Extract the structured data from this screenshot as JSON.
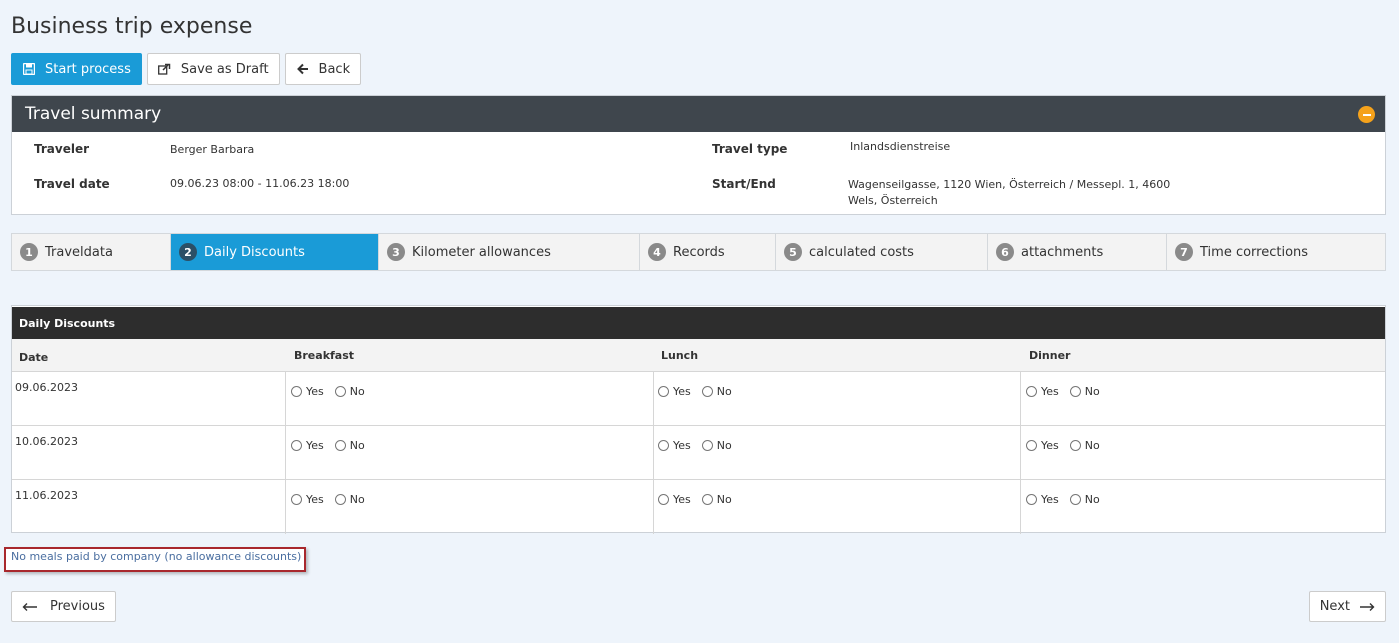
{
  "page": {
    "title": "Business trip expense"
  },
  "toolbar": {
    "start_label": "Start process",
    "draft_label": "Save as Draft",
    "back_label": "Back"
  },
  "summary": {
    "title": "Travel summary",
    "traveler_label": "Traveler",
    "traveler_value": "Berger Barbara",
    "date_label": "Travel date",
    "date_value": "09.06.23 08:00 - 11.06.23 18:00",
    "type_label": "Travel type",
    "type_value": "Inlandsdienstreise",
    "startend_label": "Start/End",
    "startend_line1": "Wagenseilgasse, 1120 Wien, Österreich / Messepl. 1, 4600",
    "startend_line2": "Wels, Österreich"
  },
  "tabs": [
    {
      "num": "1",
      "label": "Traveldata"
    },
    {
      "num": "2",
      "label": "Daily Discounts"
    },
    {
      "num": "3",
      "label": "Kilometer allowances"
    },
    {
      "num": "4",
      "label": "Records"
    },
    {
      "num": "5",
      "label": "calculated costs"
    },
    {
      "num": "6",
      "label": "attachments"
    },
    {
      "num": "7",
      "label": "Time corrections"
    }
  ],
  "active_tab": 2,
  "discounts": {
    "title": "Daily Discounts",
    "columns": [
      "Date",
      "Breakfast",
      "Lunch",
      "Dinner"
    ],
    "yes_label": "Yes",
    "no_label": "No",
    "rows": [
      {
        "date": "09.06.2023"
      },
      {
        "date": "10.06.2023"
      },
      {
        "date": "11.06.2023"
      }
    ]
  },
  "meals_link": "No meals paid by company (no allowance discounts)",
  "nav": {
    "previous": "Previous",
    "next": "Next"
  },
  "colors": {
    "accent": "#1a9bd7",
    "header_dark": "#3f464d",
    "collapse": "#f5a21b",
    "highlight_border": "#a8282d"
  }
}
